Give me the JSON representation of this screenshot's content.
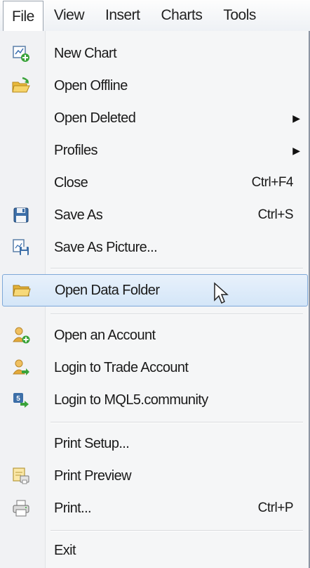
{
  "menubar": {
    "items": [
      "File",
      "View",
      "Insert",
      "Charts",
      "Tools"
    ],
    "active_index": 0
  },
  "file_menu": {
    "items": [
      {
        "label": "New Chart",
        "icon": "new-chart-icon",
        "shortcut": ""
      },
      {
        "label": "Open Offline",
        "icon": "open-folder-icon",
        "shortcut": ""
      },
      {
        "label": "Open Deleted",
        "icon": "",
        "shortcut": "",
        "submenu": true
      },
      {
        "label": "Profiles",
        "icon": "",
        "shortcut": "",
        "submenu": true
      },
      {
        "label": "Close",
        "icon": "",
        "shortcut": "Ctrl+F4"
      },
      {
        "label": "Save As",
        "icon": "floppy-disk-icon",
        "shortcut": "Ctrl+S"
      },
      {
        "label": "Save As Picture...",
        "icon": "save-picture-icon",
        "shortcut": ""
      },
      {
        "label": "Open Data Folder",
        "icon": "folder-icon",
        "shortcut": "",
        "highlighted": true
      },
      {
        "label": "Open an Account",
        "icon": "user-add-icon",
        "shortcut": ""
      },
      {
        "label": "Login to Trade Account",
        "icon": "user-login-icon",
        "shortcut": ""
      },
      {
        "label": "Login to MQL5.community",
        "icon": "mql5-login-icon",
        "shortcut": ""
      },
      {
        "label": "Print Setup...",
        "icon": "",
        "shortcut": ""
      },
      {
        "label": "Print Preview",
        "icon": "print-preview-icon",
        "shortcut": ""
      },
      {
        "label": "Print...",
        "icon": "printer-icon",
        "shortcut": "Ctrl+P"
      },
      {
        "label": "Exit",
        "icon": "",
        "shortcut": ""
      }
    ]
  },
  "colors": {
    "highlight_border": "#7ea8d8",
    "highlight_fill": "#d4e6f8",
    "menu_bg": "#f5f6f7"
  }
}
